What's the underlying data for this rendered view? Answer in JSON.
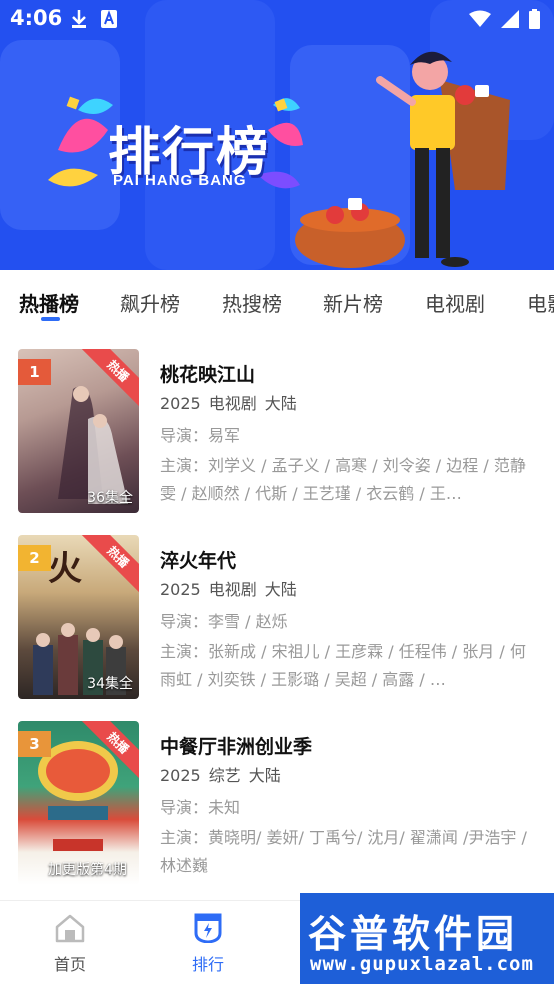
{
  "status_bar": {
    "time": "4:06"
  },
  "banner": {
    "title": "排行榜",
    "subtitle": "PAI HANG BANG"
  },
  "colors": {
    "accent": "#2e6cf6",
    "banner_bg": "#2350f0",
    "hot": "#e94b4b"
  },
  "tabs": [
    {
      "label": "热播榜",
      "active": true
    },
    {
      "label": "飙升榜",
      "active": false
    },
    {
      "label": "热搜榜",
      "active": false
    },
    {
      "label": "新片榜",
      "active": false
    },
    {
      "label": "电视剧",
      "active": false
    },
    {
      "label": "电影",
      "active": false
    }
  ],
  "items": [
    {
      "rank": "1",
      "rank_color": "#e45a3a",
      "hot_label": "热播",
      "episode_label": "36集全",
      "title": "桃花映江山",
      "year": "2025",
      "type": "电视剧",
      "region": "大陆",
      "director": "导演：易军",
      "cast": "主演：刘学义 / 孟子义 / 高寒 / 刘令姿 / 边程 / 范静雯 / 赵顺然 / 代斯 / 王艺瑾 / 衣云鹤 / 王…"
    },
    {
      "rank": "2",
      "rank_color": "#f2b431",
      "hot_label": "热播",
      "episode_label": "34集全",
      "title": "淬火年代",
      "year": "2025",
      "type": "电视剧",
      "region": "大陆",
      "director": "导演：李雪 / 赵烁",
      "cast": "主演：张新成 / 宋祖儿 / 王彦霖 / 任程伟 / 张月 / 何雨虹 / 刘奕铁 / 王影璐 / 吴超 / 高露 / …"
    },
    {
      "rank": "3",
      "rank_color": "#e8953a",
      "hot_label": "热播",
      "episode_label": "加更版第4期",
      "title": "中餐厅非洲创业季",
      "year": "2025",
      "type": "综艺",
      "region": "大陆",
      "director": "导演：未知",
      "cast": "主演：黄晓明/ 姜妍/ 丁禹兮/ 沈月/ 翟潇闻 /尹浩宇 /林述巍"
    }
  ],
  "bottom_nav": [
    {
      "label": "首页",
      "icon": "home-icon",
      "active": false
    },
    {
      "label": "排行",
      "icon": "ranking-icon",
      "active": true
    }
  ],
  "watermark": {
    "main": "谷普软件园",
    "url": "www.gupuxlazal.com"
  }
}
